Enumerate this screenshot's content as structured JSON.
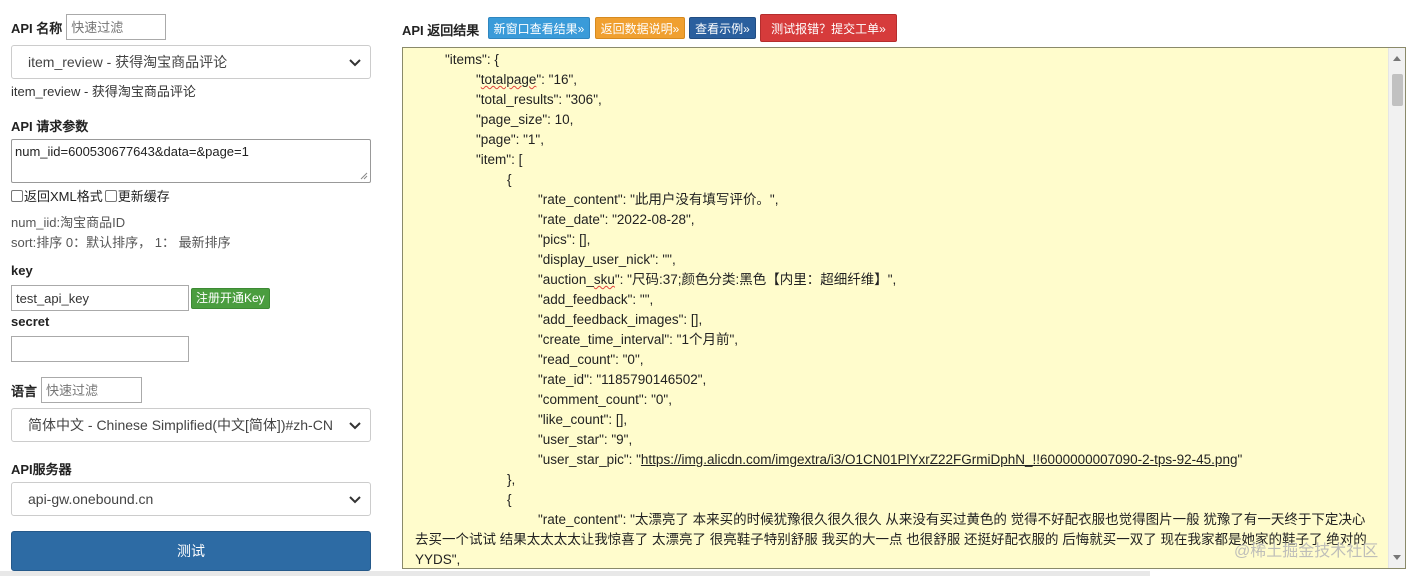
{
  "left": {
    "api_name_label": "API 名称",
    "api_name_filter_placeholder": "快速过滤",
    "api_select_value": "item_review - 获得淘宝商品评论",
    "api_desc": "item_review - 获得淘宝商品评论",
    "params_label": "API 请求参数",
    "params_value": "num_iid=600530677643&data=&page=1",
    "checkbox_xml": "返回XML格式",
    "checkbox_cache": "更新缓存",
    "hint_num_iid": "num_iid:淘宝商品ID",
    "hint_sort": "sort:排序 0：默认排序，  1：  最新排序",
    "key_label": "key",
    "key_value": "test_api_key",
    "register_btn": "注册开通Key",
    "secret_label": "secret",
    "secret_value": "",
    "lang_label": "语言",
    "lang_filter_placeholder": "快速过滤",
    "lang_select_value": "简体中文 - Chinese Simplified(中文[简体])#zh-CN",
    "server_label": "API服务器",
    "server_select_value": "api-gw.onebound.cn",
    "test_btn": "测试"
  },
  "header": {
    "result_label": "API 返回结果",
    "btn_new_window": "新窗口查看结果»",
    "btn_data_desc": "返回数据说明»",
    "btn_example": "查看示例»",
    "btn_report": "测试报错？提交工单»"
  },
  "colors": {
    "btn_new_window": "#3a9bd9",
    "btn_data_desc": "#f0a030",
    "btn_example": "#2a5f9e",
    "btn_report": "#d63b3b",
    "result_bg": "#fffccc"
  },
  "json_lines": {
    "l1": "\"items\": {",
    "l2a": "\"",
    "l2b": "totalpage",
    "l2c": "\": \"16\",",
    "l3": "\"total_results\": \"306\",",
    "l4": "\"page_size\": 10,",
    "l5": "\"page\": \"1\",",
    "l6": "\"item\": [",
    "l7": "{",
    "l8": "\"rate_content\": \"此用户没有填写评价。\",",
    "l9": "\"rate_date\": \"2022-08-28\",",
    "l10": "\"pics\": [],",
    "l11": "\"display_user_nick\": \"\",",
    "l12a": "\"auction_",
    "l12b": "sku",
    "l12c": "\": \"尺码:37;颜色分类:黑色【内里：超细纤维】\",",
    "l13": "\"add_feedback\": \"\",",
    "l14": "\"add_feedback_images\": [],",
    "l15": "\"create_time_interval\": \"1个月前\",",
    "l16": "\"read_count\": \"0\",",
    "l17": "\"rate_id\": \"1185790146502\",",
    "l18": "\"comment_count\": \"0\",",
    "l19": "\"like_count\": [],",
    "l20": "\"user_star\": \"9\",",
    "l21a": "\"user_star_pic\": \"",
    "l21b": "https://img.alicdn.com/imgextra/i3/O1CN01PlYxrZ22FGrmiDphN_!!6000000007090-2-tps-92-45.png",
    "l21c": "\"",
    "l22": "},",
    "l23": "{",
    "l24": "\"rate_content\": \"太漂亮了 本来买的时候犹豫很久很久很久 从来没有买过黄色的 觉得不好配衣服也觉得图片一般 犹豫了有一天终于下定决心去买一个试试 结果太太太太让我惊喜了 太漂亮了 很亮鞋子特别舒服 我买的大一点 也很舒服 还挺好配衣服的 后悔就买一双了 现在我家都是她家的鞋子了 绝对的YYDS\","
  },
  "watermark": "@稀土掘金技术社区"
}
